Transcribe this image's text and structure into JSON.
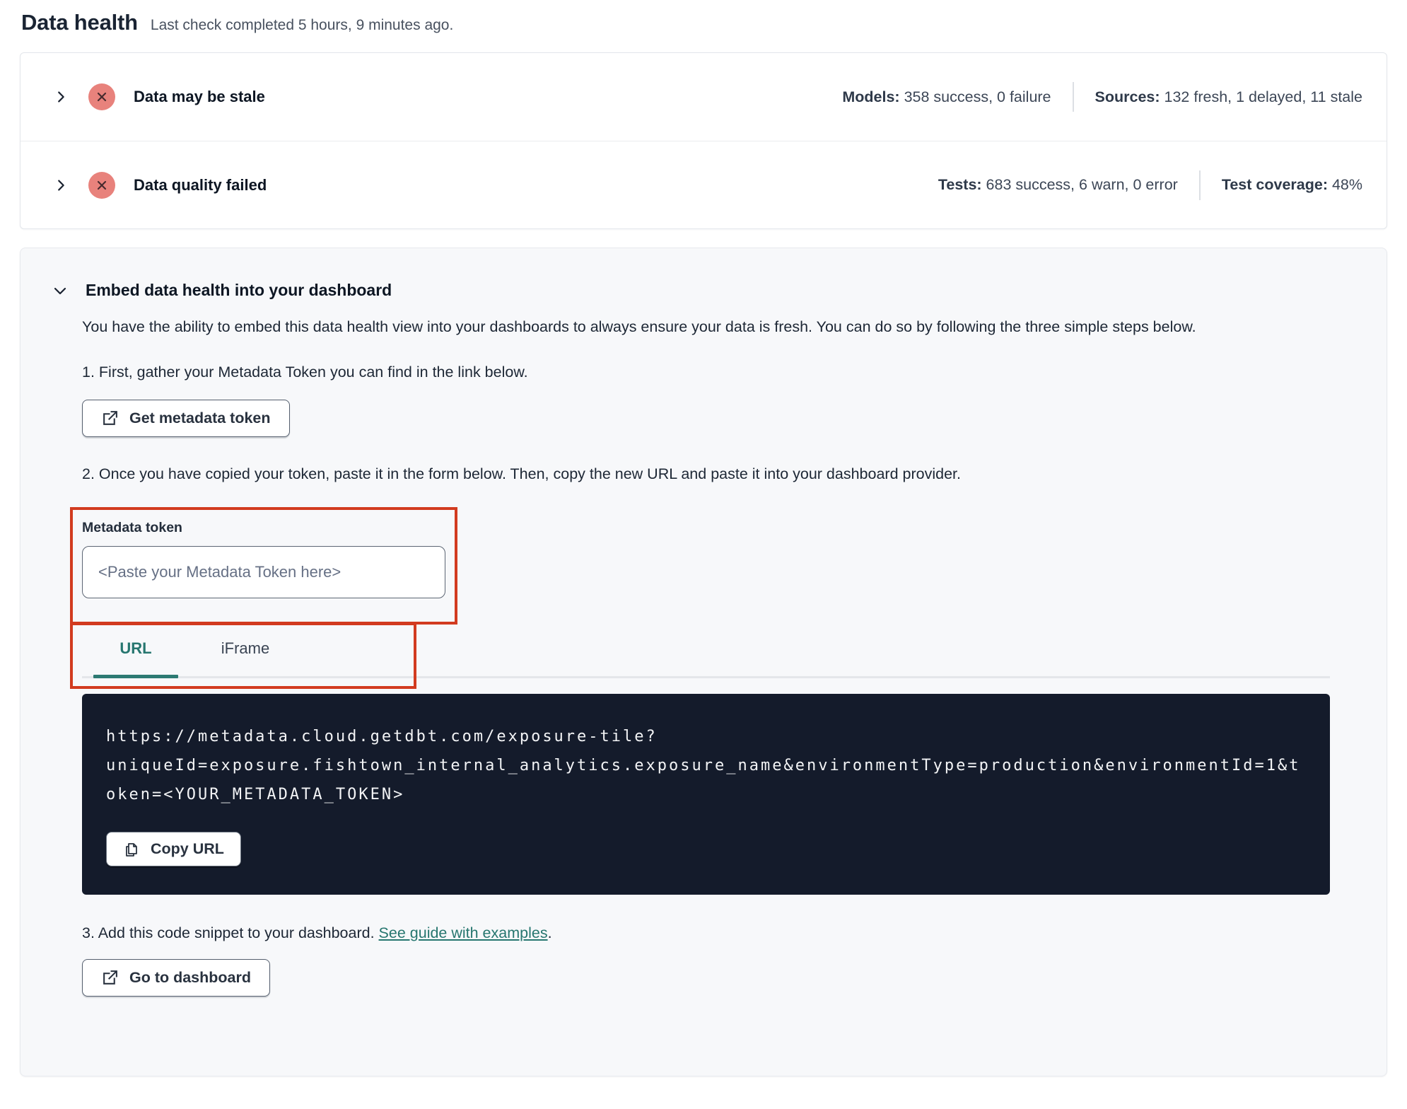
{
  "page": {
    "title": "Data health",
    "subtitle": "Last check completed 5 hours, 9 minutes ago."
  },
  "status_rows": [
    {
      "title": "Data may be stale",
      "status": "error",
      "stats": [
        {
          "label": "Models:",
          "value": " 358 success, 0 failure"
        },
        {
          "label": "Sources:",
          "value": " 132 fresh, 1 delayed, 11 stale"
        }
      ]
    },
    {
      "title": "Data quality failed",
      "status": "error",
      "stats": [
        {
          "label": "Tests:",
          "value": " 683 success, 6 warn, 0 error"
        },
        {
          "label": "Test coverage:",
          "value": " 48%"
        }
      ]
    }
  ],
  "embed": {
    "title": "Embed data health into your dashboard",
    "description": "You have the ability to embed this data health view into your dashboards to always ensure your data is fresh. You can do so by following the three simple steps below.",
    "step1": "1. First, gather your Metadata Token you can find in the link below.",
    "get_token_button": "Get metadata token",
    "step2": "2. Once you have copied your token, paste it in the form below. Then, copy the new URL and paste it into your dashboard provider.",
    "token_label": "Metadata token",
    "token_placeholder": "<Paste your Metadata Token here>",
    "token_value": "",
    "tabs": [
      {
        "label": "URL",
        "active": true
      },
      {
        "label": "iFrame",
        "active": false
      }
    ],
    "code_url": "https://metadata.cloud.getdbt.com/exposure-tile?uniqueId=exposure.fishtown_internal_analytics.exposure_name&environmentType=production&environmentId=1&token=<YOUR_METADATA_TOKEN>",
    "copy_button": "Copy URL",
    "step3_prefix": "3. Add this code snippet to your dashboard. ",
    "step3_link": "See guide with examples",
    "step3_suffix": ".",
    "dashboard_button": "Go to dashboard"
  },
  "icons": {
    "chevron_right": "chevron-right-icon",
    "chevron_down": "chevron-down-icon",
    "error_circle_x": "error-circle-x-icon",
    "external_link": "external-link-icon",
    "copy": "copy-icon"
  },
  "colors": {
    "status_error_bg": "#e8827c",
    "status_error_x": "#472a2e",
    "accent_teal": "#26766f",
    "annotation_red": "#d23b1f",
    "code_block_bg": "#141b2b",
    "embed_card_bg": "#f7f8fa"
  }
}
